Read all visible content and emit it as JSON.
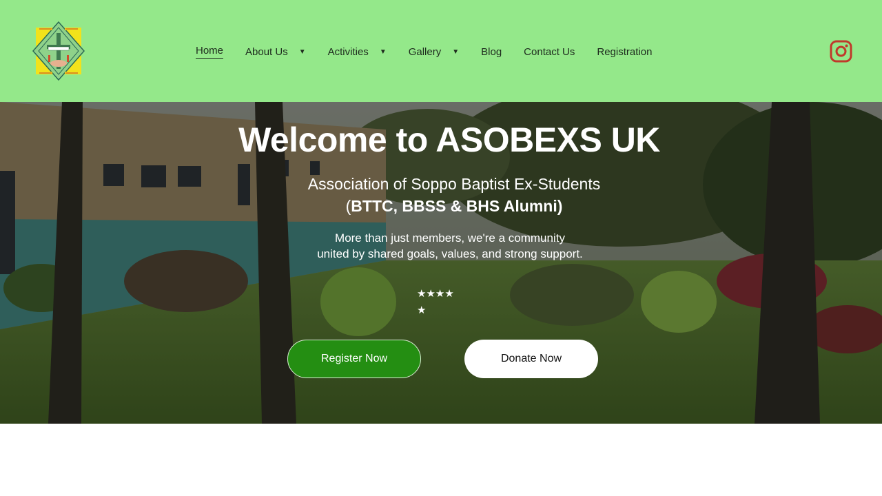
{
  "header": {
    "logo_icon": "asobexs-crest-logo",
    "nav": [
      {
        "label": "Home",
        "active": true,
        "has_dropdown": false
      },
      {
        "label": "About Us",
        "active": false,
        "has_dropdown": true
      },
      {
        "label": "Activities",
        "active": false,
        "has_dropdown": true
      },
      {
        "label": "Gallery",
        "active": false,
        "has_dropdown": true
      },
      {
        "label": "Blog",
        "active": false,
        "has_dropdown": false
      },
      {
        "label": "Contact Us",
        "active": false,
        "has_dropdown": false
      },
      {
        "label": "Registration",
        "active": false,
        "has_dropdown": false
      }
    ],
    "caret_glyph": "▼",
    "social_icon": "instagram-icon"
  },
  "hero": {
    "title": "Welcome to ASOBEXS UK",
    "subtitle_line1": "Association of Soppo Baptist Ex-Students",
    "subtitle_line2_open": "(",
    "subtitle_line2_bold": "BTTC, BBSS & BHS Alumni)",
    "description_line1": "More than just members, we're a community",
    "description_line2": "united by shared goals, values, and strong support.",
    "stars_line1": "★★★★",
    "stars_line2": "★",
    "register_label": "Register Now",
    "donate_label": "Donate Now"
  },
  "colors": {
    "header_bg": "#94e88a",
    "register_bg": "#248e12",
    "instagram": "#c0392b",
    "text_dark": "#1d2a1d"
  }
}
